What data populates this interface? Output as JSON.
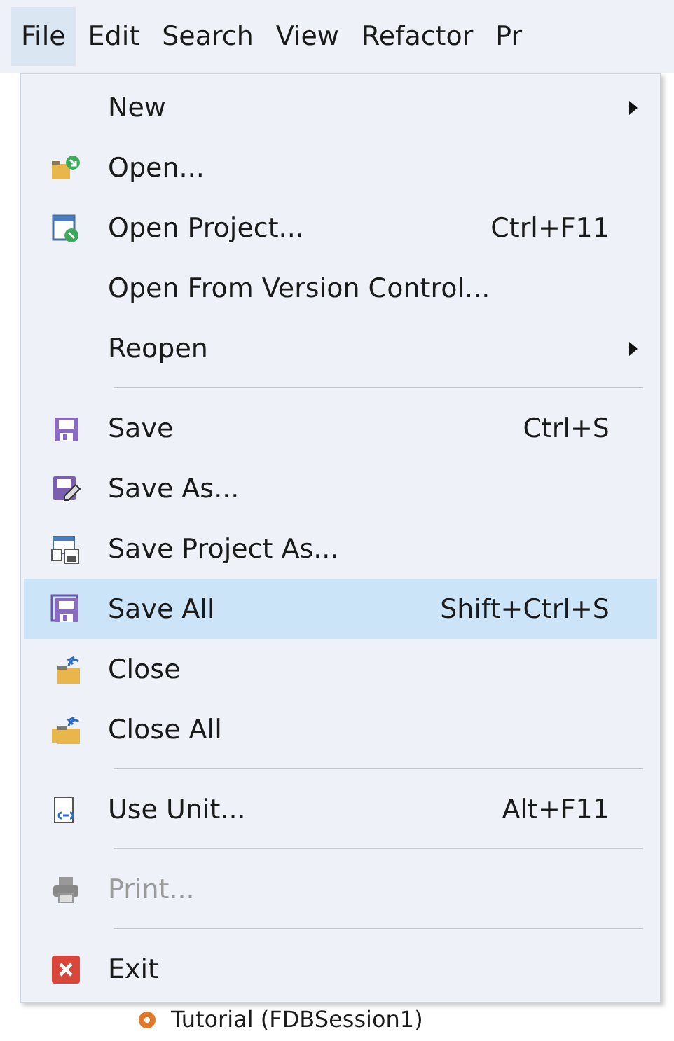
{
  "menu_bar": [
    {
      "label": "File",
      "selected": true
    },
    {
      "label": "Edit",
      "selected": false
    },
    {
      "label": "Search",
      "selected": false
    },
    {
      "label": "View",
      "selected": false
    },
    {
      "label": "Refactor",
      "selected": false
    },
    {
      "label": "Pr",
      "selected": false
    }
  ],
  "file_menu": [
    {
      "kind": "item",
      "label": "New",
      "submenu": true,
      "selected": false,
      "disabled": false
    },
    {
      "kind": "item",
      "label": "Open...",
      "submenu": false,
      "selected": false,
      "disabled": false
    },
    {
      "kind": "item",
      "label": "Open Project...",
      "shortcut": "Ctrl+F11",
      "submenu": false,
      "selected": false,
      "disabled": false
    },
    {
      "kind": "item",
      "label": "Open From Version Control...",
      "submenu": false,
      "selected": false,
      "disabled": false
    },
    {
      "kind": "item",
      "label": "Reopen",
      "submenu": true,
      "selected": false,
      "disabled": false
    },
    {
      "kind": "separator"
    },
    {
      "kind": "item",
      "label": "Save",
      "shortcut": "Ctrl+S",
      "submenu": false,
      "selected": false,
      "disabled": false
    },
    {
      "kind": "item",
      "label": "Save As...",
      "submenu": false,
      "selected": false,
      "disabled": false
    },
    {
      "kind": "item",
      "label": "Save Project As...",
      "submenu": false,
      "selected": false,
      "disabled": false
    },
    {
      "kind": "item",
      "label": "Save All",
      "shortcut": "Shift+Ctrl+S",
      "submenu": false,
      "selected": true,
      "disabled": false
    },
    {
      "kind": "item",
      "label": "Close",
      "submenu": false,
      "selected": false,
      "disabled": false
    },
    {
      "kind": "item",
      "label": "Close All",
      "submenu": false,
      "selected": false,
      "disabled": false
    },
    {
      "kind": "separator"
    },
    {
      "kind": "item",
      "label": "Use Unit...",
      "shortcut": "Alt+F11",
      "submenu": false,
      "selected": false,
      "disabled": false
    },
    {
      "kind": "separator"
    },
    {
      "kind": "item",
      "label": "Print...",
      "submenu": false,
      "selected": false,
      "disabled": true
    },
    {
      "kind": "separator"
    },
    {
      "kind": "item",
      "label": "Exit",
      "submenu": false,
      "selected": false,
      "disabled": false
    }
  ],
  "project_tree_item": {
    "label": "Tutorial (FDBSession1)"
  }
}
